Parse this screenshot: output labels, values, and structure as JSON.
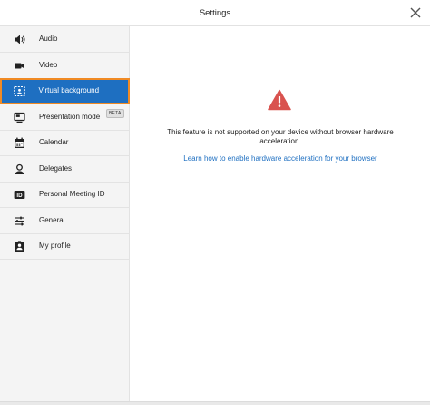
{
  "header": {
    "title": "Settings",
    "close_icon": "close-icon"
  },
  "sidebar": {
    "items": [
      {
        "label": "Audio",
        "icon": "speaker-icon"
      },
      {
        "label": "Video",
        "icon": "video-camera-icon"
      },
      {
        "label": "Virtual background",
        "icon": "virtual-background-icon",
        "active": true
      },
      {
        "label": "Presentation mode",
        "icon": "presentation-icon",
        "badge": "BETA"
      },
      {
        "label": "Calendar",
        "icon": "calendar-icon"
      },
      {
        "label": "Delegates",
        "icon": "delegates-icon"
      },
      {
        "label": "Personal Meeting ID",
        "icon": "id-badge-icon"
      },
      {
        "label": "General",
        "icon": "sliders-icon"
      },
      {
        "label": "My profile",
        "icon": "profile-icon"
      }
    ]
  },
  "main": {
    "warning_icon": "warning-triangle-icon",
    "message_line1": "This feature is not supported on your device without browser hardware",
    "message_line2": "acceleration.",
    "help_link": "Learn how to enable hardware acceleration for your browser"
  },
  "colors": {
    "accent": "#1e6fc1",
    "active_outline": "#f08a24",
    "warning": "#d9534f",
    "sidebar_bg": "#f4f4f4"
  }
}
